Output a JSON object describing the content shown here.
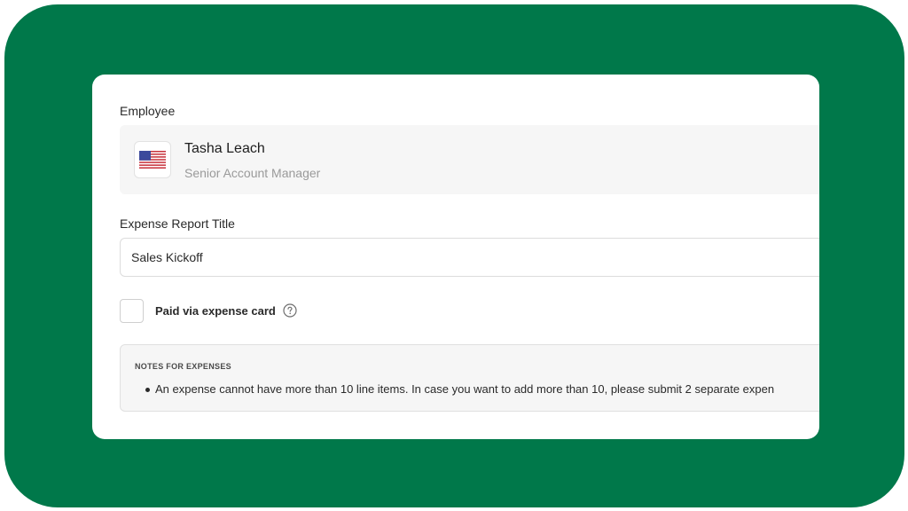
{
  "employee": {
    "section_label": "Employee",
    "name": "Tasha Leach",
    "role": "Senior Account Manager",
    "flag_icon": "us-flag-icon"
  },
  "report_title": {
    "section_label": "Expense Report Title",
    "value": "Sales Kickoff"
  },
  "expense_card": {
    "label": "Paid via expense card",
    "checked": false,
    "help_icon": "question-circle-icon"
  },
  "notes": {
    "heading": "NOTES FOR EXPENSES",
    "items": [
      "An expense cannot have more than 10 line items. In case you want to add more than 10, please submit 2 separate expen"
    ]
  },
  "colors": {
    "frame_background": "#00784a",
    "card_background": "#ffffff",
    "panel_background": "#f6f6f6"
  }
}
